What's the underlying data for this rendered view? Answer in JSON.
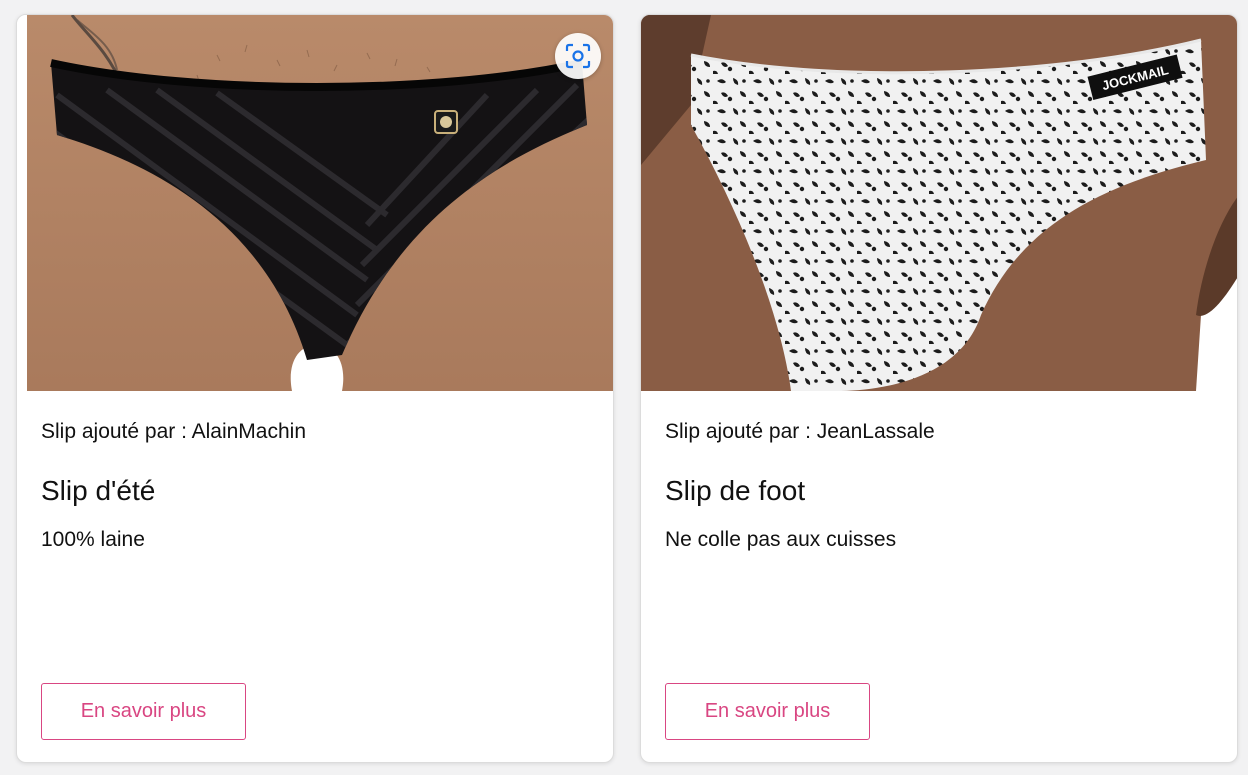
{
  "colors": {
    "accent": "#d94682",
    "lens_icon": "#1a73e8",
    "text": "#111111"
  },
  "cards": [
    {
      "author_text": "Slip ajouté par : AlainMachin",
      "title": "Slip d'été",
      "description": "100% laine",
      "button_label": "En savoir plus",
      "image_icon": "black-striped-brief-photo"
    },
    {
      "author_text": "Slip ajouté par : JeanLassale",
      "title": "Slip de foot",
      "description": "Ne colle pas aux cuisses",
      "button_label": "En savoir plus",
      "image_icon": "leopard-print-brief-photo",
      "brand_label": "JOCKMAIL"
    }
  ],
  "overlay": {
    "lens_icon": "visual-search-icon"
  }
}
